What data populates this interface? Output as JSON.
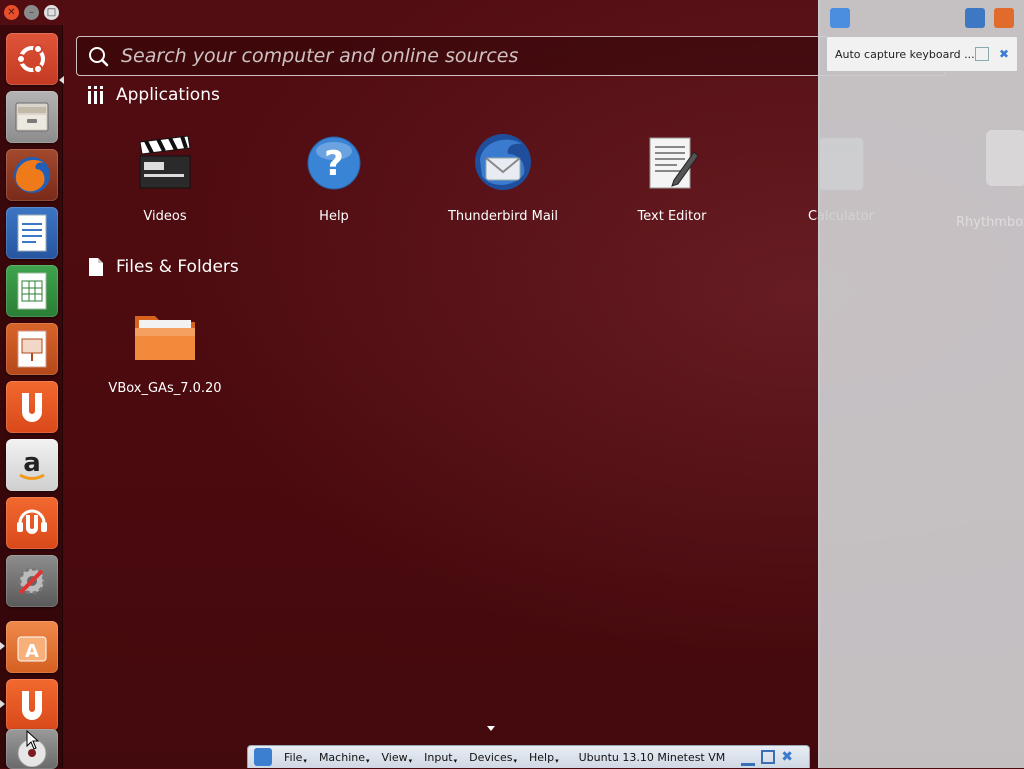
{
  "search": {
    "placeholder": "Search your computer and online sources"
  },
  "sections": {
    "applications": {
      "title": "Applications",
      "items": [
        {
          "label": "Videos",
          "icon": "video-clapper-icon"
        },
        {
          "label": "Help",
          "icon": "help-icon"
        },
        {
          "label": "Thunderbird Mail",
          "icon": "thunderbird-icon"
        },
        {
          "label": "Text Editor",
          "icon": "text-editor-icon"
        },
        {
          "label": "Calculator",
          "icon": "calculator-icon"
        },
        {
          "label": "Rhythmbox",
          "icon": "rhythmbox-icon"
        }
      ]
    },
    "files": {
      "title": "Files & Folders",
      "items": [
        {
          "label": "VBox_GAs_7.0.20",
          "icon": "folder-icon"
        }
      ]
    }
  },
  "launcher": [
    "ubuntu-logo-icon",
    "files-icon",
    "firefox-icon",
    "writer-icon",
    "calc-icon",
    "impress-icon",
    "ubuntu-one-icon",
    "amazon-icon",
    "ubuntu-one-music-icon",
    "system-settings-icon",
    "software-center-icon",
    "ubuntu-one-icon",
    "dvd-icon"
  ],
  "vbox_panel": {
    "notice": "Auto capture keyboard ..."
  },
  "vbox_bar": {
    "menus": [
      "File",
      "Machine",
      "View",
      "Input",
      "Devices",
      "Help"
    ],
    "vm_name": "Ubuntu 13.10 Minetest VM"
  },
  "colors": {
    "dash_bg": "#4a0b0f",
    "ubuntu_orange": "#e95420",
    "vbox_panel": "#cdcdd0"
  }
}
